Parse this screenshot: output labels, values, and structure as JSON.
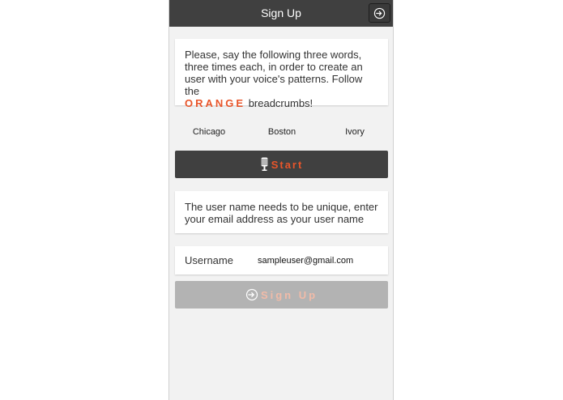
{
  "header": {
    "title": "Sign Up",
    "login_icon": "sign-in-icon"
  },
  "instructions": {
    "text_before": "Please, say the following three words, three times each, in order to create an user with your voice's patterns. Follow the",
    "highlight": "ORANGE",
    "text_after": "breadcrumbs!"
  },
  "words": [
    "Chicago",
    "Boston",
    "Ivory"
  ],
  "start_button": {
    "icon": "microphone-icon",
    "label": "Start"
  },
  "unique_note": {
    "text": "The user name needs to be unique, enter your email address as your user name"
  },
  "username": {
    "label": "Username",
    "value": "sampleuser@gmail.com"
  },
  "signup_button": {
    "icon": "sign-in-icon",
    "label": "Sign Up",
    "enabled": false
  },
  "colors": {
    "header_bg": "#404040",
    "accent": "#e8552a",
    "disabled_button": "#b3b3b3",
    "background": "#f2f2f2"
  }
}
